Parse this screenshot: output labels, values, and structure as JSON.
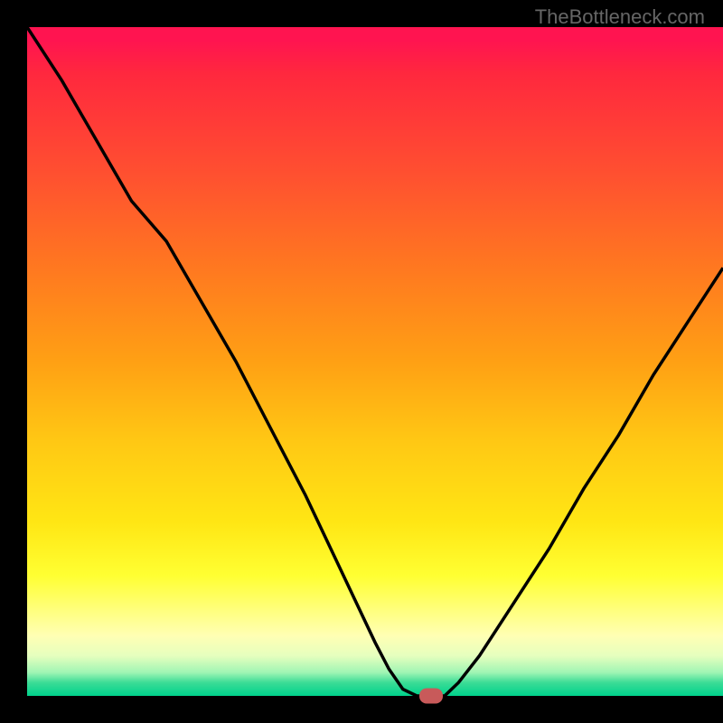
{
  "watermark": "TheBottleneck.com",
  "chart_data": {
    "type": "line",
    "title": "",
    "xlabel": "",
    "ylabel": "",
    "x": [
      0,
      5,
      10,
      15,
      20,
      25,
      30,
      35,
      40,
      45,
      50,
      52,
      54,
      56,
      58,
      60,
      62,
      65,
      70,
      75,
      80,
      85,
      90,
      95,
      100
    ],
    "values": [
      100,
      92,
      83,
      74,
      68,
      59,
      50,
      40,
      30,
      19,
      8,
      4,
      1,
      0,
      0,
      0,
      2,
      6,
      14,
      22,
      31,
      39,
      48,
      56,
      64
    ],
    "xlim": [
      0,
      100
    ],
    "ylim": [
      0,
      100
    ],
    "marker_position": {
      "x": 58,
      "y": 0
    },
    "gradient_colors": {
      "top": "#ff1450",
      "upper_mid": "#ff7820",
      "mid": "#ffc814",
      "lower_mid": "#ffff32",
      "bottom": "#00d28c"
    }
  }
}
